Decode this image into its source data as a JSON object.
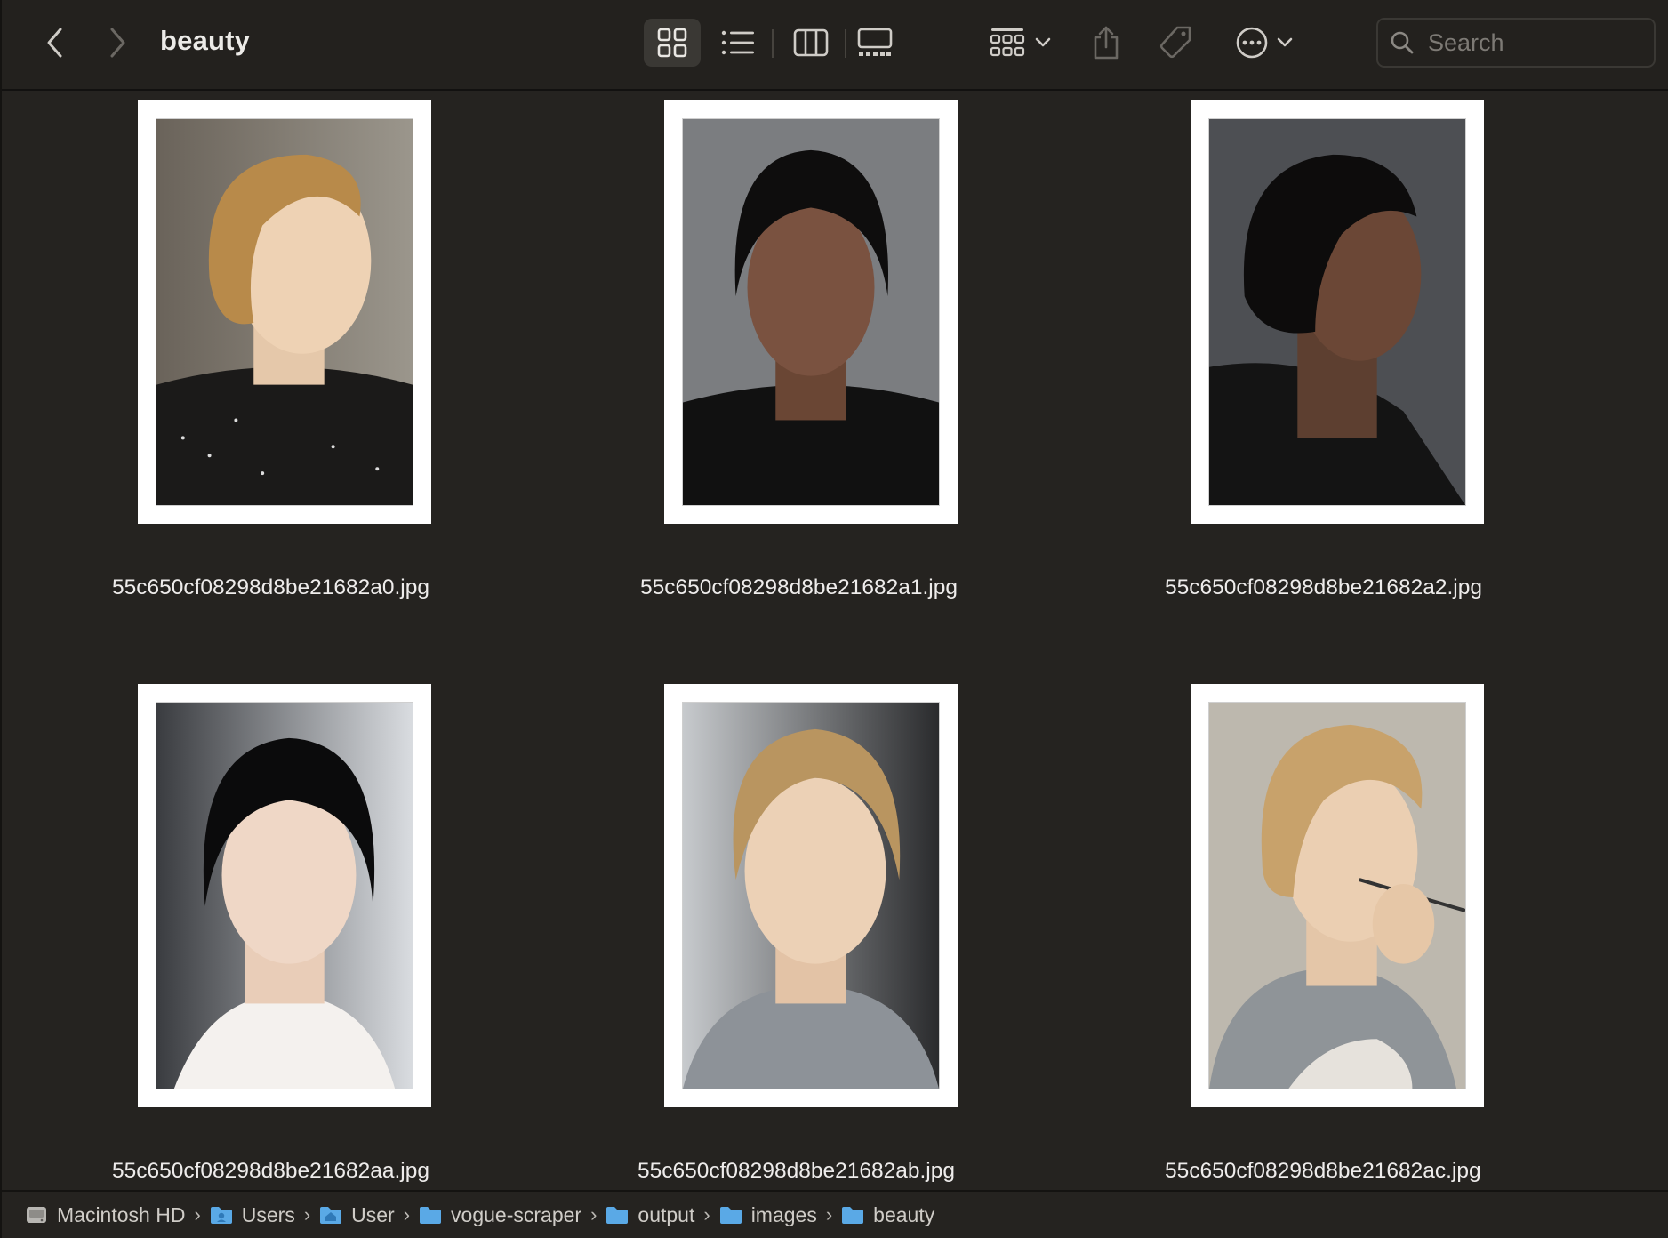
{
  "window": {
    "title": "beauty"
  },
  "toolbar": {
    "back_icon": "chevron-left-icon",
    "forward_icon": "chevron-right-icon",
    "views": [
      "icon-view",
      "list-view",
      "column-view",
      "gallery-view"
    ],
    "active_view": "icon-view",
    "group_icon": "group-icon",
    "share_icon": "share-icon",
    "tag_icon": "tag-icon",
    "more_icon": "ellipsis-circle-icon"
  },
  "search": {
    "placeholder": "Search",
    "value": ""
  },
  "files": [
    {
      "name": "55c650cf08298d8be21682a0.jpg"
    },
    {
      "name": "55c650cf08298d8be21682a1.jpg"
    },
    {
      "name": "55c650cf08298d8be21682a2.jpg"
    },
    {
      "name": "55c650cf08298d8be21682aa.jpg"
    },
    {
      "name": "55c650cf08298d8be21682ab.jpg"
    },
    {
      "name": "55c650cf08298d8be21682ac.jpg"
    }
  ],
  "pathbar": {
    "items": [
      {
        "label": "Macintosh HD",
        "icon": "hard-drive-icon"
      },
      {
        "label": "Users",
        "icon": "folder-icon"
      },
      {
        "label": "User",
        "icon": "home-folder-icon"
      },
      {
        "label": "vogue-scraper",
        "icon": "folder-icon"
      },
      {
        "label": "output",
        "icon": "folder-icon"
      },
      {
        "label": "images",
        "icon": "folder-icon"
      },
      {
        "label": "beauty",
        "icon": "folder-icon"
      }
    ]
  },
  "colors": {
    "window_bg": "#252320",
    "toolbar_bg": "#23211e",
    "folder_blue": "#5aa9e6"
  }
}
